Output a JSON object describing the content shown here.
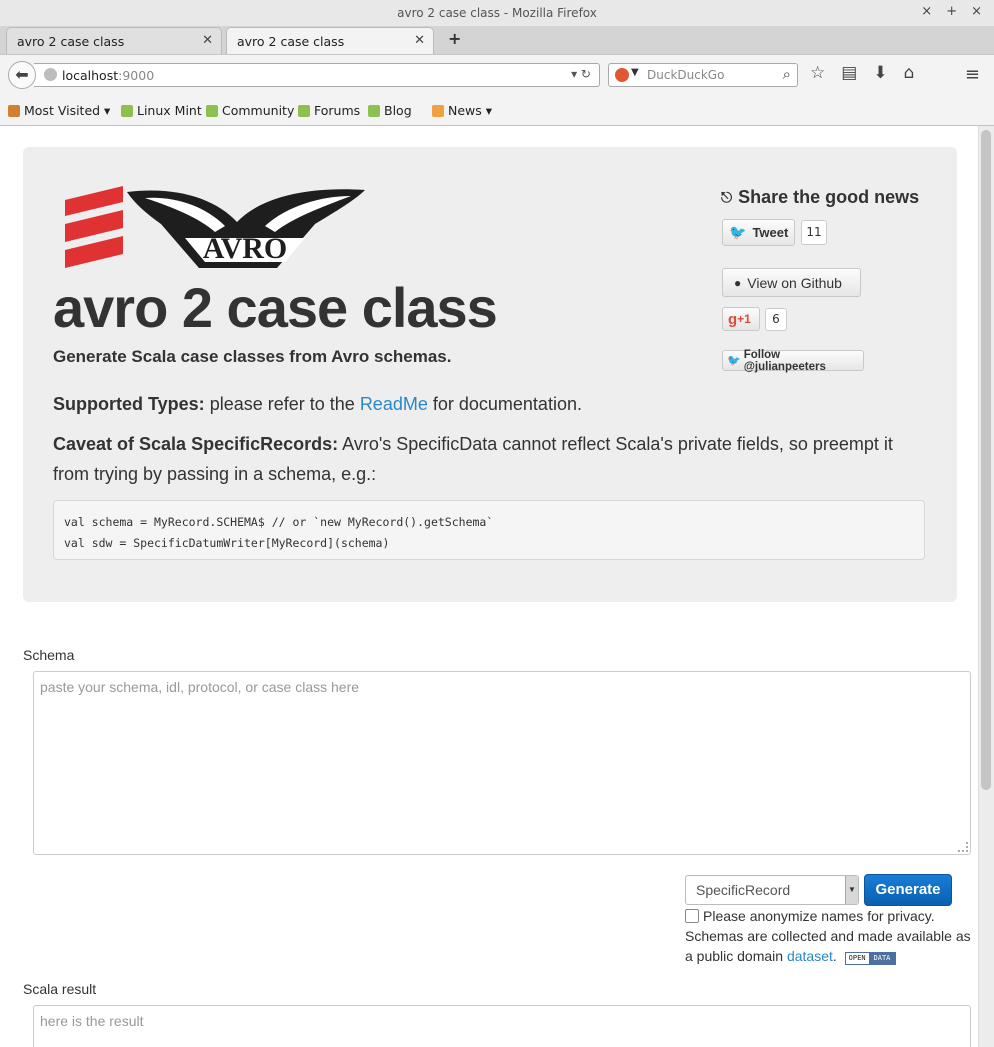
{
  "window": {
    "title": "avro 2 case class - Mozilla Firefox",
    "controls": [
      "×",
      "+",
      "×"
    ]
  },
  "tabs": [
    {
      "label": "avro 2 case class",
      "close": "✕"
    },
    {
      "label": "avro 2 case class",
      "close": "✕"
    }
  ],
  "new_tab": "+",
  "nav": {
    "back": "⬅",
    "url_host": "localhost",
    "url_port": ":9000",
    "search_placeholder": "DuckDuckGo",
    "icons": [
      "☆",
      "▤",
      "⬇",
      "⌂"
    ],
    "menu": "≡"
  },
  "bookmarks": [
    {
      "label": "Most Visited ▾"
    },
    {
      "label": "Linux Mint"
    },
    {
      "label": "Community"
    },
    {
      "label": "Forums"
    },
    {
      "label": "Blog"
    },
    {
      "label": "News ▾"
    }
  ],
  "hero": {
    "logo_text": "AVRO",
    "title": "avro 2 case class",
    "lead": "Generate Scala case classes from Avro schemas.",
    "supported_label": "Supported Types:",
    "supported_pre": "please refer to the",
    "supported_link": "ReadMe",
    "supported_post": "for documentation.",
    "caveat_label": "Caveat of Scala SpecificRecords:",
    "caveat_text": "Avro's SpecificData cannot reflect Scala's private fields, so preempt it from trying by passing in a schema, e.g.:",
    "code_line1": "val schema = MyRecord.SCHEMA$ // or `new MyRecord().getSchema`",
    "code_line2": "val sdw = SpecificDatumWriter[MyRecord](schema)"
  },
  "share": {
    "title": "Share the good news",
    "tweet_label": "Tweet",
    "tweet_count": "11",
    "github_label": "View on Github",
    "gplus_label": "+1",
    "gplus_count": "6",
    "follow_label": "Follow @julianpeeters"
  },
  "form": {
    "schema_label": "Schema",
    "schema_placeholder": "paste your schema, idl, protocol, or case class here",
    "select_value": "SpecificRecord",
    "generate_label": "Generate",
    "privacy_text": "Please anonymize names for privacy.",
    "collected_text": "Schemas are collected and made available as a public domain",
    "dataset_link": "dataset",
    "open_badge_left": "OPEN",
    "open_badge_right": "DATA",
    "result_label": "Scala result",
    "result_placeholder": "here is the result"
  }
}
